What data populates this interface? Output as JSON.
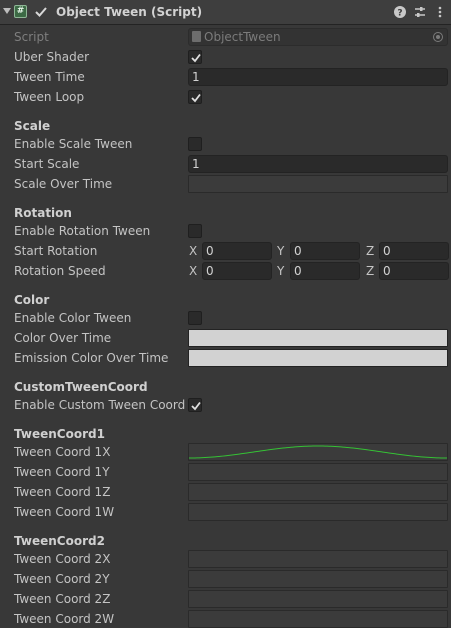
{
  "header": {
    "title": "Object Tween (Script)"
  },
  "script_field": {
    "label": "Script",
    "value": "ObjectTween"
  },
  "rows": {
    "uber_shader": "Uber Shader",
    "tween_time": "Tween Time",
    "tween_time_value": "1",
    "tween_loop": "Tween Loop"
  },
  "scale": {
    "header": "Scale",
    "enable": "Enable Scale Tween",
    "start": "Start Scale",
    "start_value": "1",
    "over_time": "Scale Over Time"
  },
  "rotation": {
    "header": "Rotation",
    "enable": "Enable Rotation Tween",
    "start": "Start Rotation",
    "speed": "Rotation Speed",
    "axis_x": "X",
    "axis_y": "Y",
    "axis_z": "Z",
    "start_x": "0",
    "start_y": "0",
    "start_z": "0",
    "speed_x": "0",
    "speed_y": "0",
    "speed_z": "0"
  },
  "color": {
    "header": "Color",
    "enable": "Enable Color Tween",
    "over_time": "Color Over Time",
    "emission": "Emission Color Over Time",
    "swatch": "#d2d2d2"
  },
  "custom": {
    "header": "CustomTweenCoord",
    "enable": "Enable Custom Tween Coord"
  },
  "coord1": {
    "header": "TweenCoord1",
    "x": "Tween Coord 1X",
    "y": "Tween Coord 1Y",
    "z": "Tween Coord 1Z",
    "w": "Tween Coord 1W"
  },
  "coord2": {
    "header": "TweenCoord2",
    "x": "Tween Coord 2X",
    "y": "Tween Coord 2Y",
    "z": "Tween Coord 2Z",
    "w": "Tween Coord 2W"
  },
  "checkboxes": {
    "component_enabled": true,
    "uber_shader": true,
    "tween_loop": true,
    "enable_scale_tween": false,
    "enable_rotation_tween": false,
    "enable_color_tween": false,
    "enable_custom_tween_coord": true
  },
  "colors": {
    "curve_line": "#35c135"
  }
}
